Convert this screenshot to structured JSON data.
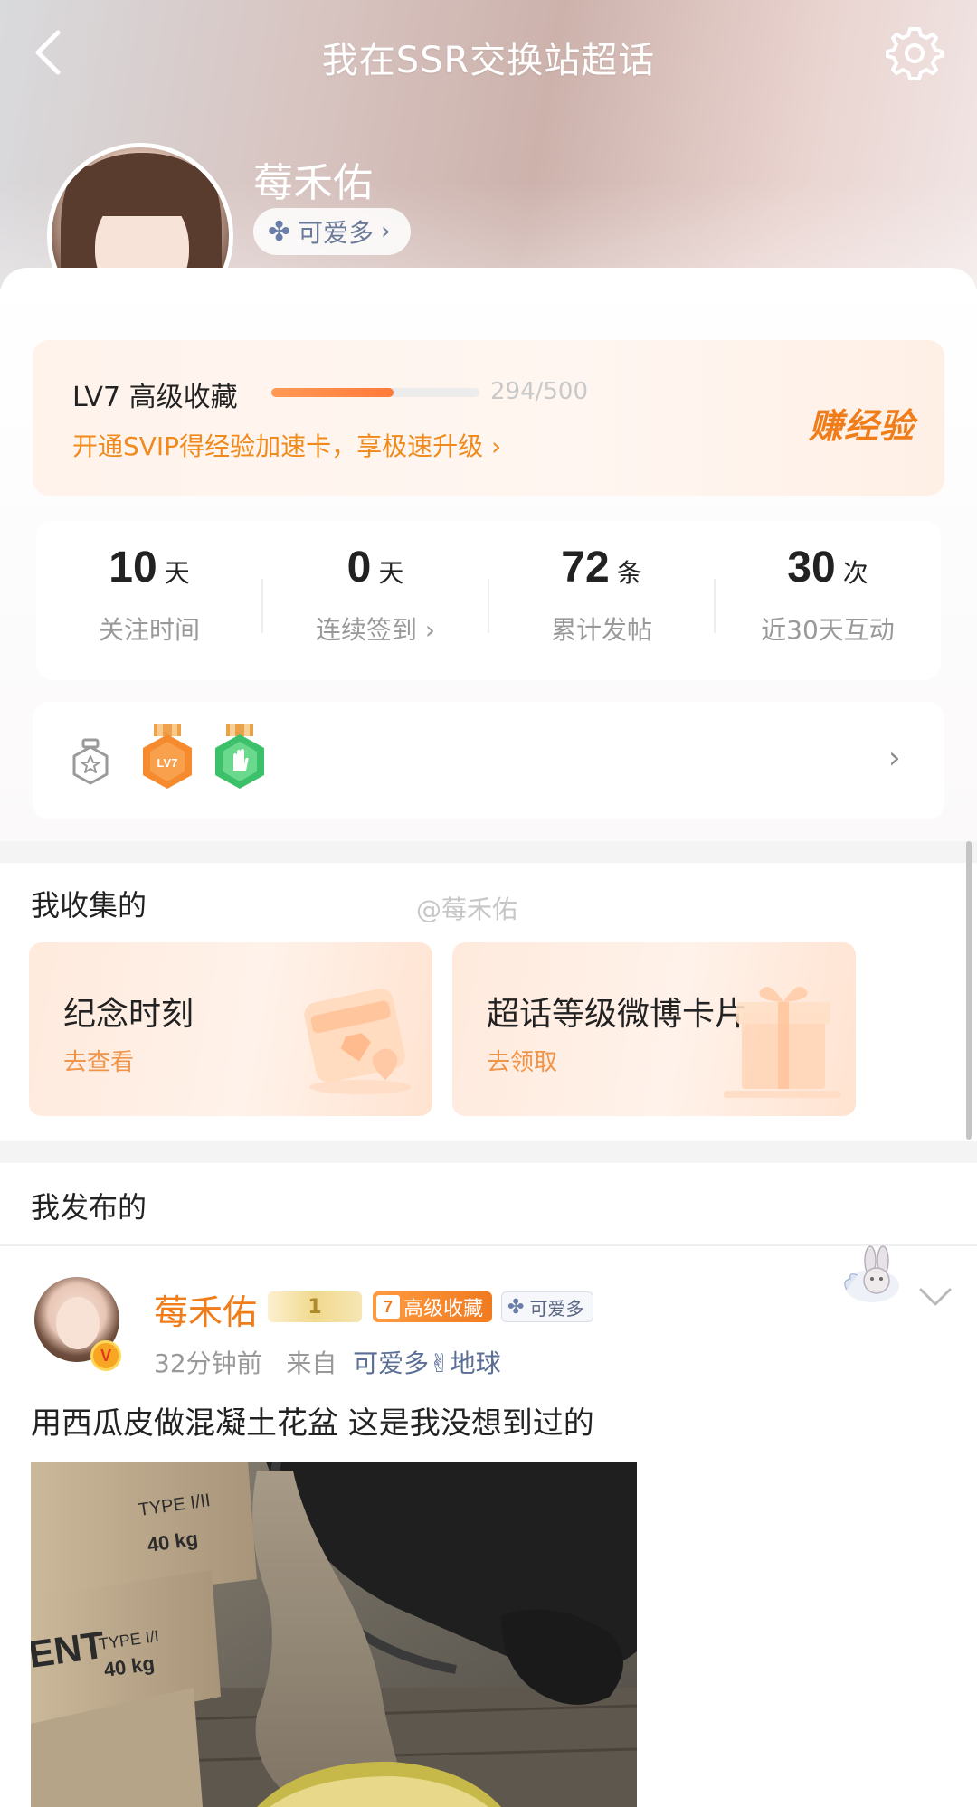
{
  "header": {
    "title": "我在SSR交换站超话"
  },
  "profile": {
    "name": "莓禾佑",
    "chip_label": "可爱多",
    "verified_mark": "V"
  },
  "level": {
    "title": "LV7 高级收藏",
    "progress_text": "294/500",
    "progress": 0.588,
    "promo": "开通SVIP得经验加速卡，享极速升级 ›",
    "earn_label": "赚经验"
  },
  "stats": [
    {
      "num": "10",
      "unit": "天",
      "label": "关注时间"
    },
    {
      "num": "0",
      "unit": "天",
      "label": "连续签到 ›"
    },
    {
      "num": "72",
      "unit": "条",
      "label": "累计发帖"
    },
    {
      "num": "30",
      "unit": "次",
      "label": "近30天互动"
    }
  ],
  "badges": {
    "badge_lv7_text": "LV7"
  },
  "collected": {
    "title": "我收集的",
    "watermark": "@莓禾佑",
    "cards": [
      {
        "title": "纪念时刻",
        "sub": "去查看"
      },
      {
        "title": "超话等级微博卡片",
        "sub": "去领取"
      }
    ]
  },
  "published": {
    "title": "我发布的"
  },
  "post": {
    "author": "莓禾佑",
    "fan_badge": "1",
    "level_num": "7",
    "level_text": "高级收藏",
    "clover_text": "可爱多",
    "time": "32分钟前",
    "from_label": "来自",
    "source": "可爱多✌地球",
    "text": "用西瓜皮做混凝土花盆 这是我没想到过的",
    "image_labels": {
      "bag1": "TYPE I/II",
      "bag2": "40 kg",
      "bag3": "ENT",
      "bag4": "TYPE I/I",
      "bag5": "40 kg"
    }
  },
  "colors": {
    "accent_orange": "#f07d1a",
    "link_blue": "#5a6e96"
  }
}
